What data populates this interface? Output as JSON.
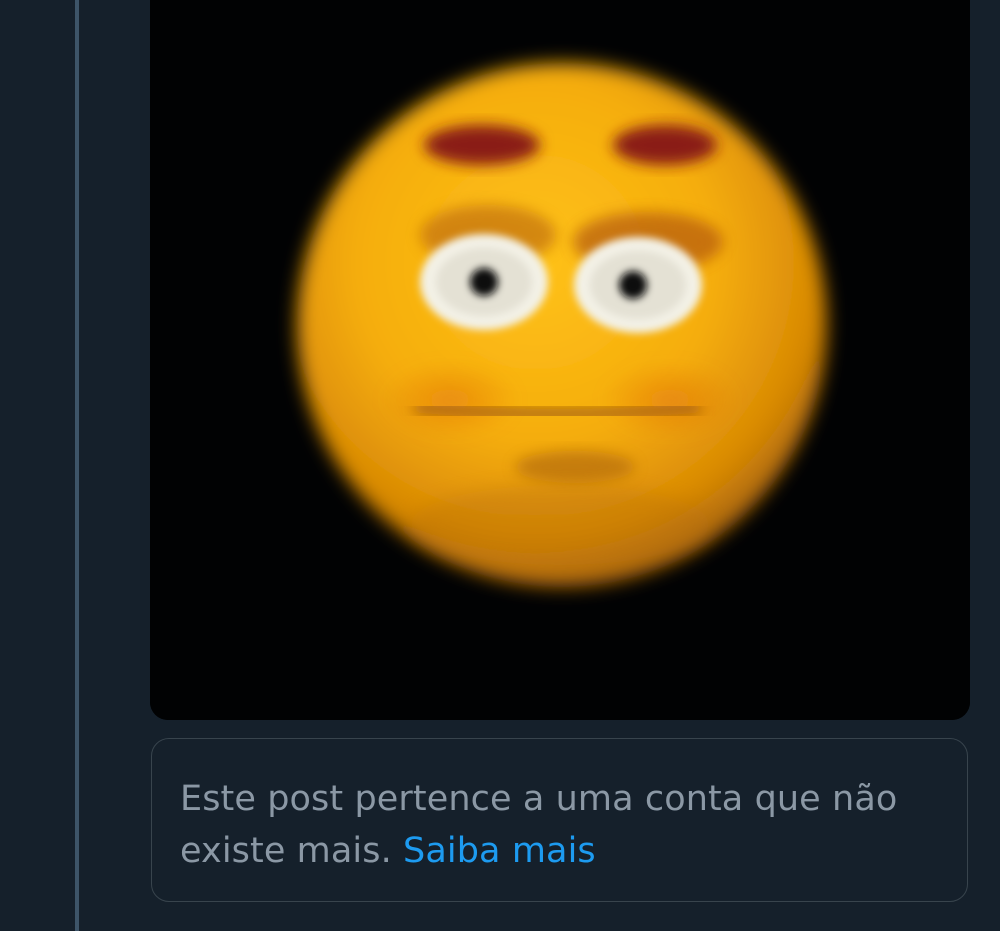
{
  "thread": {
    "connector_color": "#3d5468"
  },
  "media": {
    "subject_icon": "flushed-face-emoji",
    "background_color": "#010203",
    "face_color": "#f5ad0c"
  },
  "notice": {
    "message": "Este post pertence a uma conta que não existe mais.",
    "link_label": "Saiba mais",
    "link_color": "#1d9bf0",
    "text_color": "#8b98a5"
  }
}
